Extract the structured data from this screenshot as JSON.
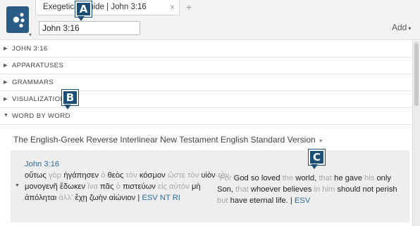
{
  "tab": {
    "title": "Exegetical Guide | John 3:16",
    "close": "×",
    "add": "+"
  },
  "reference": {
    "value": "John 3:16"
  },
  "toolbar": {
    "add_label": "Add"
  },
  "sections": [
    {
      "label": "JOHN 3:16",
      "expanded": false
    },
    {
      "label": "APPARATUSES",
      "expanded": false
    },
    {
      "label": "GRAMMARS",
      "expanded": false
    },
    {
      "label": "VISUALIZATIONS",
      "expanded": false
    },
    {
      "label": "WORD BY WORD",
      "expanded": true
    }
  ],
  "resource": {
    "title": "The English-Greek Reverse Interlinear New Testament English Standard Version"
  },
  "passage": {
    "reference": "John 3:16",
    "greek_tokens": [
      {
        "t": "οὕτως",
        "dim": false
      },
      {
        "t": "γὰρ",
        "dim": true
      },
      {
        "t": "ἠγάπησεν",
        "dim": false
      },
      {
        "t": "ὁ",
        "dim": true
      },
      {
        "t": "θεὸς",
        "dim": false
      },
      {
        "t": "τὸν",
        "dim": true
      },
      {
        "t": "κόσμον",
        "dim": false
      },
      {
        "t": "ὥστε",
        "dim": true
      },
      {
        "t": "τὸν",
        "dim": true
      },
      {
        "t": "υἱὸν",
        "dim": false
      },
      {
        "t": "τὸν",
        "dim": true
      },
      {
        "t": "μονογενῆ",
        "dim": false
      },
      {
        "t": "ἔδωκεν",
        "dim": false
      },
      {
        "t": "ἵνα",
        "dim": true
      },
      {
        "t": "πᾶς",
        "dim": false
      },
      {
        "t": "ὁ",
        "dim": true
      },
      {
        "t": "πιστεύων",
        "dim": false
      },
      {
        "t": "εἰς",
        "dim": true
      },
      {
        "t": "αὐτὸν",
        "dim": true
      },
      {
        "t": "μὴ",
        "dim": false
      },
      {
        "t": "ἀπόληται",
        "dim": false
      },
      {
        "t": "ἀλλʼ",
        "dim": true
      },
      {
        "t": "ἔχῃ",
        "dim": false
      },
      {
        "t": "ζωὴν",
        "dim": false
      },
      {
        "t": "αἰώνιον",
        "dim": false
      }
    ],
    "greek_source": "ESV NT RI",
    "english_tokens": [
      {
        "t": "“For",
        "dim": true
      },
      {
        "t": "God",
        "dim": false
      },
      {
        "t": "so",
        "dim": false
      },
      {
        "t": "loved",
        "dim": false
      },
      {
        "t": "the",
        "dim": true
      },
      {
        "t": "world,",
        "dim": false
      },
      {
        "t": "that",
        "dim": true
      },
      {
        "t": "he",
        "dim": false
      },
      {
        "t": "gave",
        "dim": false
      },
      {
        "t": "his",
        "dim": true
      },
      {
        "t": "only",
        "dim": false
      },
      {
        "t": "Son,",
        "dim": false
      },
      {
        "t": "that",
        "dim": true
      },
      {
        "t": "whoever",
        "dim": false
      },
      {
        "t": "believes",
        "dim": false
      },
      {
        "t": "in",
        "dim": true
      },
      {
        "t": "him",
        "dim": true
      },
      {
        "t": "should",
        "dim": false
      },
      {
        "t": "not",
        "dim": false
      },
      {
        "t": "perish",
        "dim": false
      },
      {
        "t": "but",
        "dim": true
      },
      {
        "t": "have",
        "dim": false
      },
      {
        "t": "eternal",
        "dim": false
      },
      {
        "t": "life.",
        "dim": false
      }
    ],
    "english_source": "ESV"
  },
  "callouts": [
    "A",
    "B",
    "C"
  ],
  "colors": {
    "callout": "#1d4e76",
    "link": "#2b6ca3",
    "logo": "#2a5c85"
  },
  "icons": {
    "app_logo": "logos-app-icon",
    "section_arrow": "triangle-right-icon"
  }
}
